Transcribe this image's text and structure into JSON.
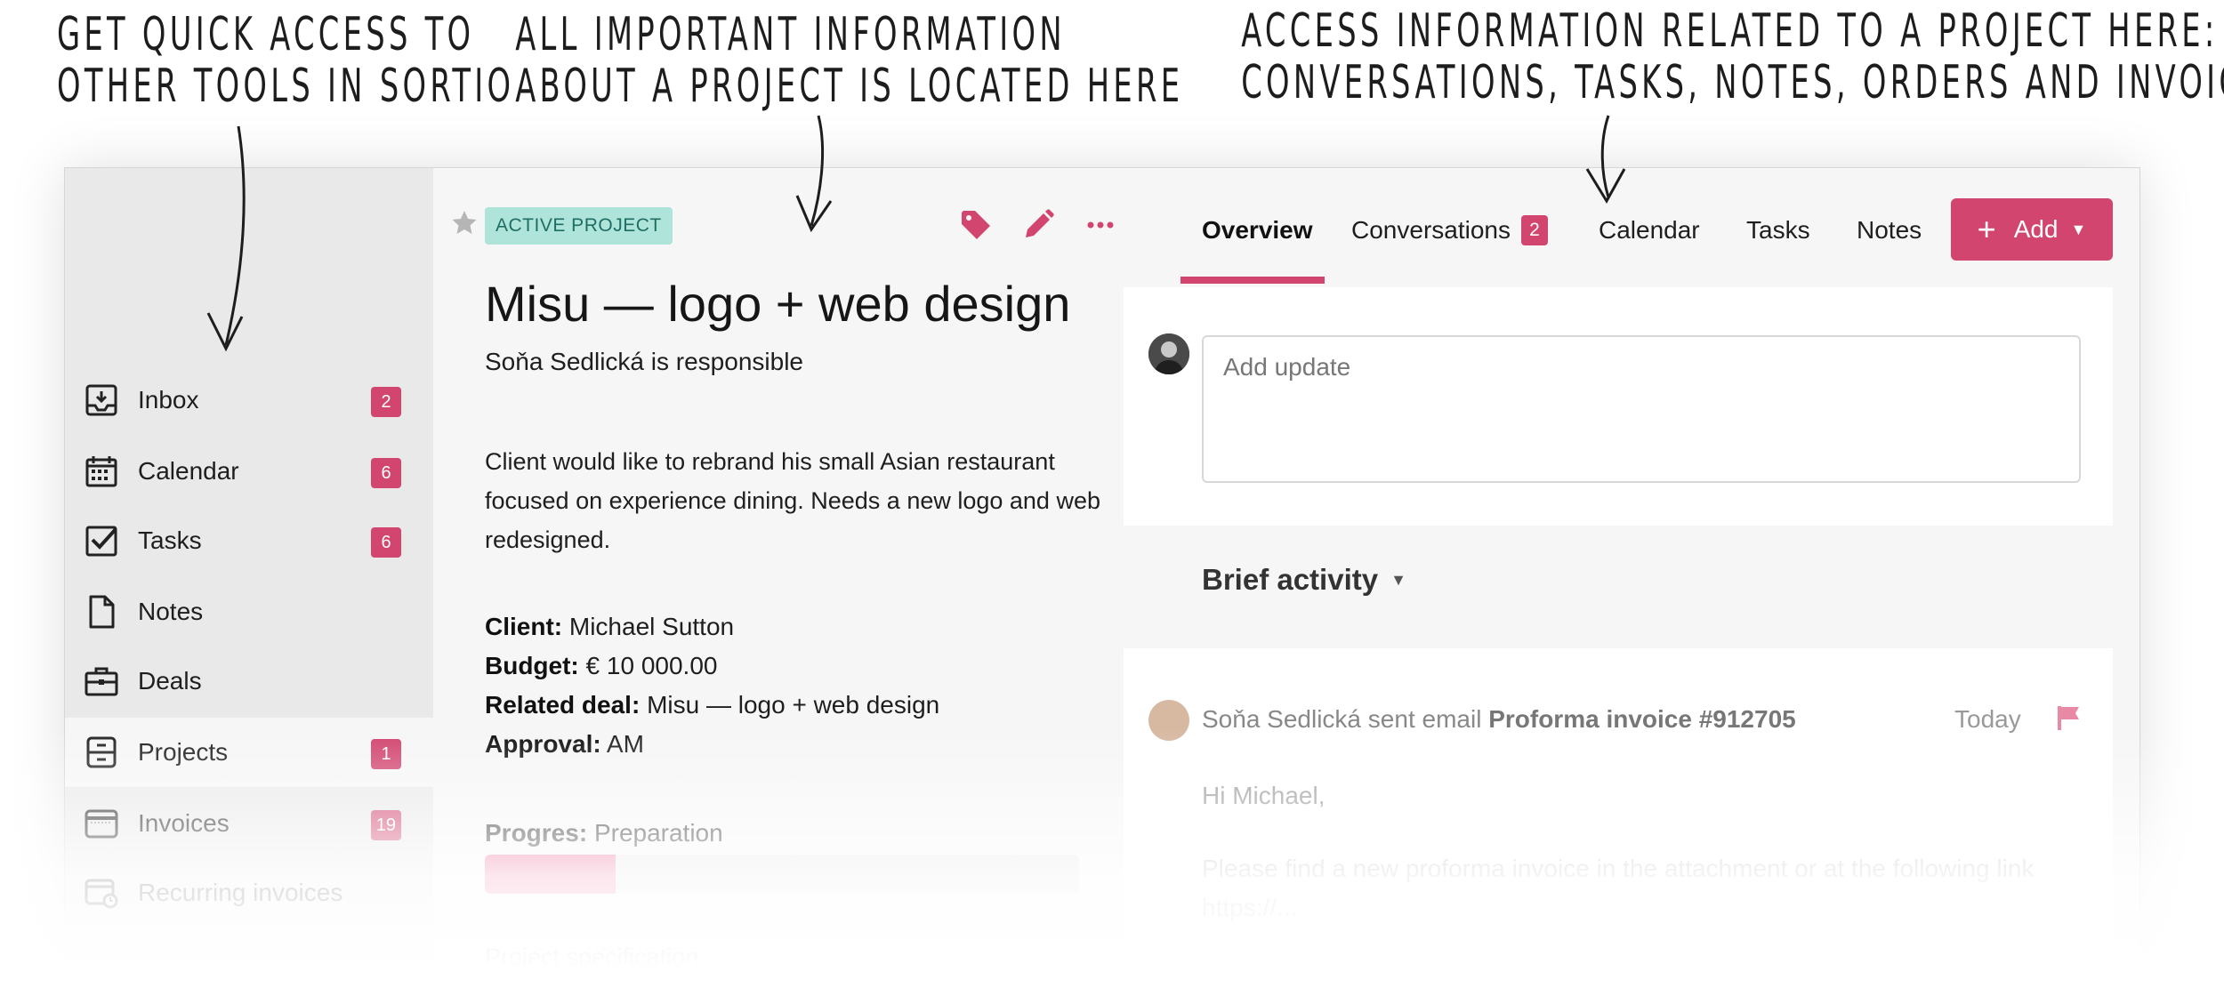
{
  "annotations": {
    "tools": [
      "GET QUICK ACCESS TO",
      "OTHER TOOLS IN SORTIO"
    ],
    "project_info": [
      "ALL IMPORTANT INFORMATION",
      "ABOUT A PROJECT IS LOCATED HERE"
    ],
    "project_tabs": [
      "ACCESS INFORMATION RELATED TO A PROJECT HERE:",
      "CONVERSATIONS, TASKS, NOTES, ORDERS AND INVOICES"
    ]
  },
  "sidebar": {
    "items": [
      {
        "label": "Inbox",
        "icon": "inbox-icon",
        "badge": "2"
      },
      {
        "label": "Calendar",
        "icon": "calendar-icon",
        "badge": "6"
      },
      {
        "label": "Tasks",
        "icon": "tasks-icon",
        "badge": "6"
      },
      {
        "label": "Notes",
        "icon": "notes-icon",
        "badge": ""
      },
      {
        "label": "Deals",
        "icon": "deals-icon",
        "badge": ""
      },
      {
        "label": "Projects",
        "icon": "projects-icon",
        "badge": "1",
        "active": true
      },
      {
        "label": "Invoices",
        "icon": "invoices-icon",
        "badge": "19"
      },
      {
        "label": "Recurring invoices",
        "icon": "recurring-invoices-icon",
        "badge": ""
      }
    ]
  },
  "project": {
    "status": "ACTIVE PROJECT",
    "title": "Misu — logo + web design",
    "responsible": "Soňa Sedlická is responsible",
    "description": "Client would like to rebrand his small Asian restaurant focused on experience dining. Needs a new logo and web redesigned.",
    "client_label": "Client:",
    "client": "Michael Sutton",
    "budget_label": "Budget:",
    "budget": "€ 10 000.00",
    "deal_label": "Related deal:",
    "deal": "Misu — logo + web design",
    "approval_label": "Approval:",
    "approval": "AM",
    "progress_label": "Progres:",
    "progress_stage": "Preparation",
    "progress_fraction": 0.22,
    "faded_label": "Project specification"
  },
  "tabs": {
    "overview": "Overview",
    "conversations": "Conversations",
    "conversations_badge": "2",
    "calendar": "Calendar",
    "tasks": "Tasks",
    "notes": "Notes",
    "add_label": "Add"
  },
  "update": {
    "placeholder": "Add update"
  },
  "activity": {
    "title": "Brief activity",
    "actor": "Soňa Sedlická",
    "action": "sent email",
    "subject": "Proforma invoice #912705",
    "date": "Today",
    "greeting": "Hi Michael,",
    "body_line1": "Please find a new proforma invoice in the attachment or at the following link",
    "body_line2": "https://..."
  },
  "colors": {
    "accent": "#d2456f",
    "status_bg": "#aee4da",
    "status_text": "#1f6e63",
    "sidebar_bg": "#e9e9e9"
  }
}
